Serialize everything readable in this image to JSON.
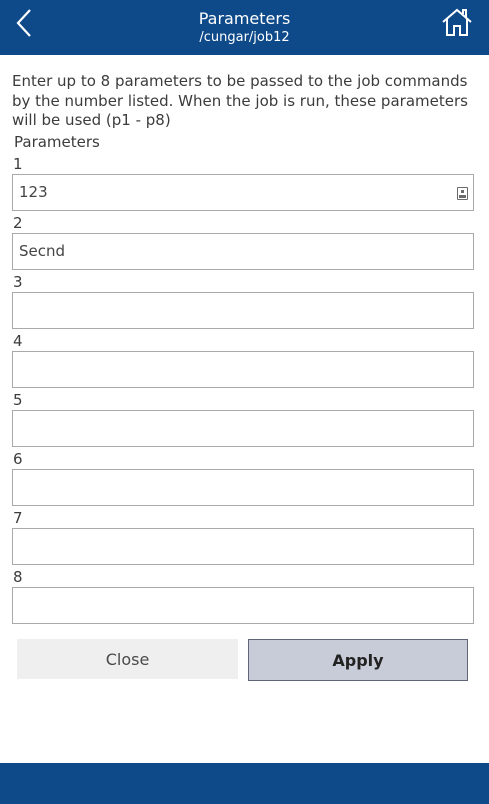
{
  "header": {
    "title": "Parameters",
    "subtitle": "/cungar/job12",
    "back_icon": "chevron-left-icon",
    "home_icon": "home-icon",
    "background_color": "#0e4a8a"
  },
  "intro": "Enter up to 8 parameters to be passed to the job commands by the number listed. When the job is run, these parameters will be used (p1 - p8)",
  "section_title": "Parameters",
  "params": [
    {
      "label": "1",
      "value": "123"
    },
    {
      "label": "2",
      "value": "Secnd"
    },
    {
      "label": "3",
      "value": ""
    },
    {
      "label": "4",
      "value": ""
    },
    {
      "label": "5",
      "value": ""
    },
    {
      "label": "6",
      "value": ""
    },
    {
      "label": "7",
      "value": ""
    },
    {
      "label": "8",
      "value": ""
    }
  ],
  "buttons": {
    "close": "Close",
    "apply": "Apply"
  }
}
